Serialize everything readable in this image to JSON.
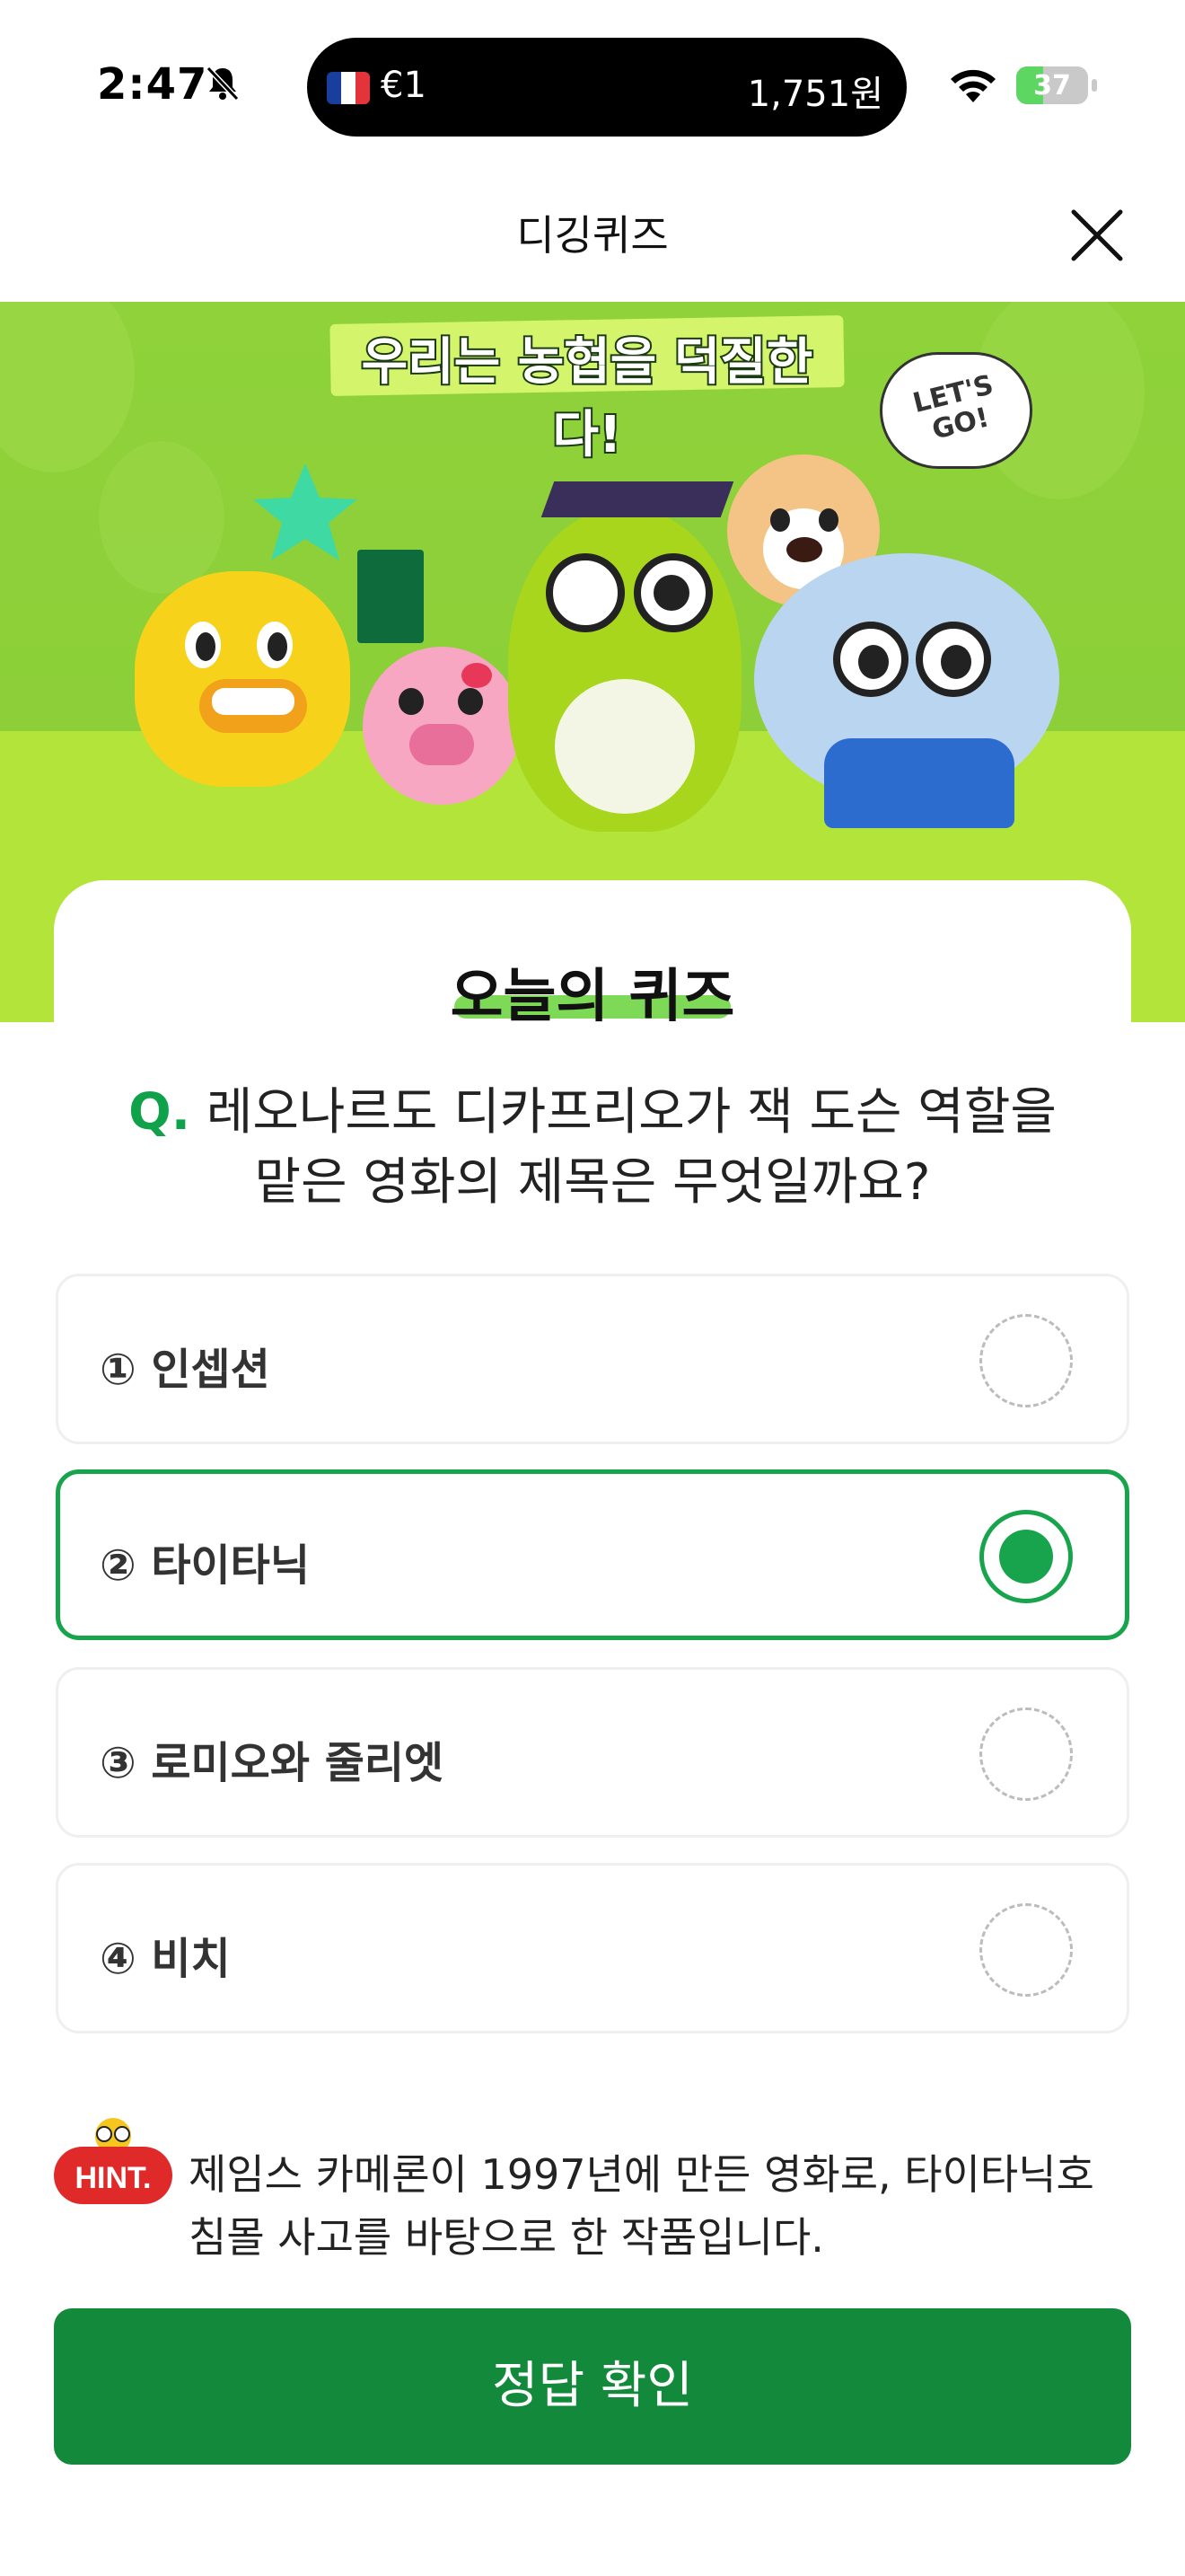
{
  "status_bar": {
    "time": "2:47",
    "island_left": "€1",
    "island_right": "1,751원",
    "battery": "37",
    "battery_level": 0.37,
    "icons": [
      "bell-slash-icon",
      "france-flag-icon",
      "wifi-icon",
      "battery-charging-icon"
    ]
  },
  "nav": {
    "title": "디깅퀴즈",
    "close_icon": "close-icon"
  },
  "banner": {
    "title": "우리는 농협을 덕질한다!",
    "speech": "LET'S GO!"
  },
  "quiz": {
    "heading": "오늘의 퀴즈",
    "question_prefix": "Q.",
    "question": "레오나르도 디카프리오가 잭 도슨 역할을 맡은 영화의 제목은 무엇일까요?",
    "options": [
      {
        "label": "① 인셉션",
        "selected": false
      },
      {
        "label": "② 타이타닉",
        "selected": true
      },
      {
        "label": "③ 로미오와 줄리엣",
        "selected": false
      },
      {
        "label": "④ 비치",
        "selected": false
      }
    ],
    "hint_label": "HINT.",
    "hint": "제임스 카메론이 1997년에 만든 영화로, 타이타닉호 침몰 사고를 바탕으로 한 작품입니다.",
    "confirm_label": "정답 확인"
  },
  "colors": {
    "accent": "#17a44c",
    "button": "#138a3b",
    "banner": "#8fd23a",
    "hint_badge": "#e02a2a"
  }
}
